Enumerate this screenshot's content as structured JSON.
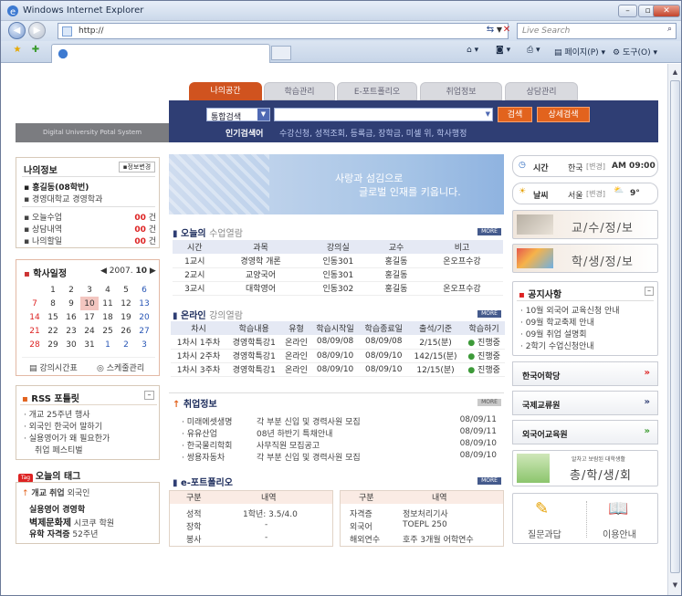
{
  "browser": {
    "title": "Windows Internet Explorer",
    "address": "http://",
    "live_search": "Live Search",
    "page_menu": "페이지(P)",
    "tools_menu": "도구(O)"
  },
  "site": {
    "tabs": [
      "나의공간",
      "학습관리",
      "E-포트폴리오",
      "취업정보",
      "상담관리"
    ],
    "brand": "Digital University Potal System",
    "search_select": "통합검색",
    "search_button": "검색",
    "detail_search_button": "상세검색",
    "keyword_label": "인기검색어",
    "keywords": "수강신청, 성적조회, 등록금, 장학금, 미셀 위, 학사행정"
  },
  "my_info": {
    "title": "나의정보",
    "edit_button": "정보변경",
    "name": "홍길동(08학번)",
    "dept": "경영대학교 경영학과",
    "rows": [
      {
        "label": "오늘수업",
        "count": "00",
        "unit": "건"
      },
      {
        "label": "상담내역",
        "count": "00",
        "unit": "건"
      },
      {
        "label": "나의할일",
        "count": "00",
        "unit": "건"
      }
    ]
  },
  "calendar": {
    "title": "학사일정",
    "year": "2007.",
    "month": "10",
    "weeks": [
      [
        "",
        "1",
        "2",
        "3",
        "4",
        "5",
        "6"
      ],
      [
        "7",
        "8",
        "9",
        "10",
        "11",
        "12",
        "13"
      ],
      [
        "14",
        "15",
        "16",
        "17",
        "18",
        "19",
        "20"
      ],
      [
        "21",
        "22",
        "23",
        "24",
        "25",
        "26",
        "27"
      ],
      [
        "28",
        "29",
        "30",
        "31",
        "1",
        "2",
        "3"
      ]
    ],
    "timetable_button": "강의시간표",
    "schedule_button": "스케줄관리"
  },
  "rss": {
    "title": "RSS 포틀릿",
    "items": [
      "개교 25주년 행사",
      "외국인 한국어 말하기",
      "실용영어가 왜 필요한가",
      "취업 페스티벌"
    ]
  },
  "tags": {
    "badge": "Tag",
    "title": "오늘의 태그",
    "line1a": "개교 취업",
    "line1b": "외국인",
    "line2": "실용영어  경영학",
    "line3a": "벽제문화제",
    "line3b": "시코쿠  학원",
    "line4a": "유학  자격증",
    "line4b": "52주년"
  },
  "banner": {
    "line1": "사랑과 섬김으로",
    "line2": "글로벌 인재를 키웁니다."
  },
  "classes": {
    "title": "오늘의",
    "title_sub": "수업열람",
    "more": "MORE",
    "headers": [
      "시간",
      "과목",
      "강의실",
      "교수",
      "비고"
    ],
    "rows": [
      [
        "1교시",
        "경영학 개론",
        "인동301",
        "홍길동",
        "온오프수강"
      ],
      [
        "2교시",
        "교양국어",
        "인동301",
        "홍길동",
        ""
      ],
      [
        "3교시",
        "대학영어",
        "인동302",
        "홍길동",
        "온오프수강"
      ]
    ]
  },
  "online": {
    "title": "온라인",
    "title_sub": "강의열람",
    "more": "MORE",
    "headers": [
      "차시",
      "학습내용",
      "유형",
      "학습시작일",
      "학습종료일",
      "출석/기준",
      "학습하기"
    ],
    "rows": [
      [
        "1차시 1주차",
        "경영학특강1",
        "온라인",
        "08/09/08",
        "08/09/08",
        "2/15(분)",
        "진행중"
      ],
      [
        "1차시 2주차",
        "경영학특강1",
        "온라인",
        "08/09/10",
        "08/09/10",
        "142/15(분)",
        "진행중"
      ],
      [
        "1차시 3주차",
        "경영학특강1",
        "온라인",
        "08/09/10",
        "08/09/10",
        "12/15(분)",
        "진행중"
      ]
    ]
  },
  "jobs": {
    "title": "취업정보",
    "more": "MORE",
    "rows": [
      [
        "미래에셋생명",
        "각 부분 신입 및 경력사원 모집",
        "08/09/11"
      ],
      [
        "유유산업",
        "08년 하반기 특채안내",
        "08/09/11"
      ],
      [
        "한국물리학회",
        "사무직원 모집공고",
        "08/09/10"
      ],
      [
        "쌍용자동차",
        "각 부분 신입 및 경력사원 모집",
        "08/09/10"
      ]
    ]
  },
  "eportfolio": {
    "title": "e-포트폴리오",
    "more": "MORE",
    "left_headers": [
      "구분",
      "내역"
    ],
    "left_rows": [
      [
        "성적",
        "1학년: 3.5/4.0"
      ],
      [
        "장학",
        "-"
      ],
      [
        "봉사",
        "-"
      ]
    ],
    "right_headers": [
      "구분",
      "내역"
    ],
    "right_rows": [
      [
        "자격증",
        "정보처리기사"
      ],
      [
        "외국어",
        "TOEPL 250"
      ],
      [
        "해외연수",
        "호주 3개월 어학연수"
      ]
    ]
  },
  "right": {
    "time_label": "시간",
    "time_region": "한국",
    "time_change": "[변경]",
    "time_value": "AM 09:00",
    "weather_label": "날씨",
    "weather_region": "서울",
    "weather_change": "[변경]",
    "weather_temp": "9°",
    "prof_info": "교/수/정/보",
    "student_info": "학/생/정/보",
    "notice_title": "공지사항",
    "notices": [
      "10월 외국어 교육신청 안내",
      "09월 학교축제 안내",
      "09월 취업 설명회",
      "2학기 수업신청안내"
    ],
    "links": [
      "한국어학당",
      "국제교류원",
      "외국어교육원"
    ],
    "alumni_small": "알차고 보람된 대학생활",
    "alumni_big": "총/학/생/회",
    "qa_label": "질문과답",
    "guide_label": "이용안내"
  },
  "colors": {
    "brand_orange": "#e2631e",
    "header_navy": "#2f3e74"
  }
}
